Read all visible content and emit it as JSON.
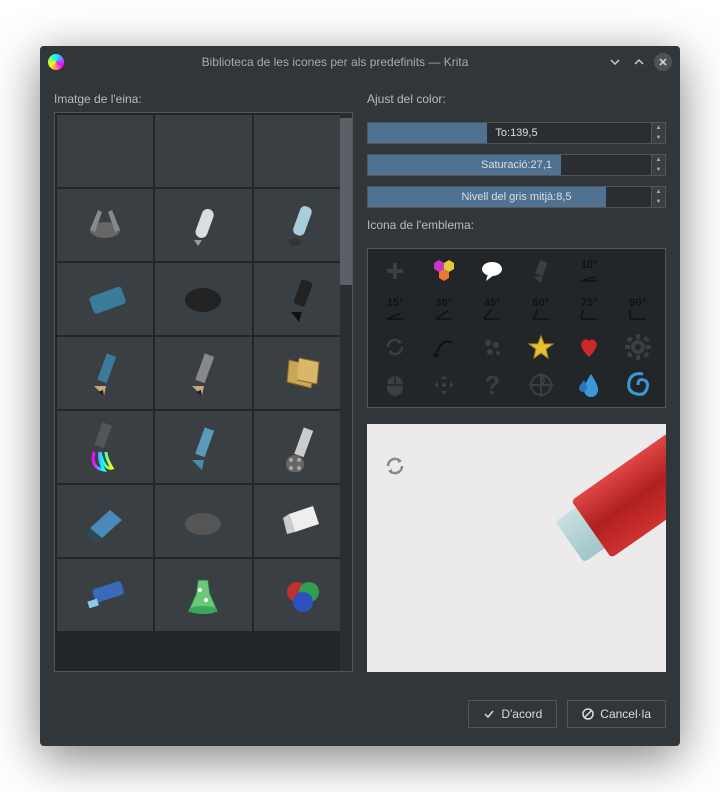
{
  "title": "Biblioteca de les icones per als predefinits — Krita",
  "left": {
    "label": "Imatge de l'eina:"
  },
  "right": {
    "adjust_label": "Ajust del color:",
    "sliders": {
      "hue": {
        "label": "To:139,5",
        "fill_pct": 40
      },
      "sat": {
        "label": "Saturació:27,1",
        "fill_pct": 65
      },
      "gray": {
        "label": "Nivell del gris mitjà:8,5",
        "fill_pct": 80
      }
    },
    "emblem_label": "Icona de l'emblema:",
    "angles": [
      "10°",
      "15°",
      "30°",
      "45°",
      "60°",
      "75°",
      "90°"
    ]
  },
  "buttons": {
    "ok": "D'acord",
    "cancel": "Cancel·la"
  }
}
